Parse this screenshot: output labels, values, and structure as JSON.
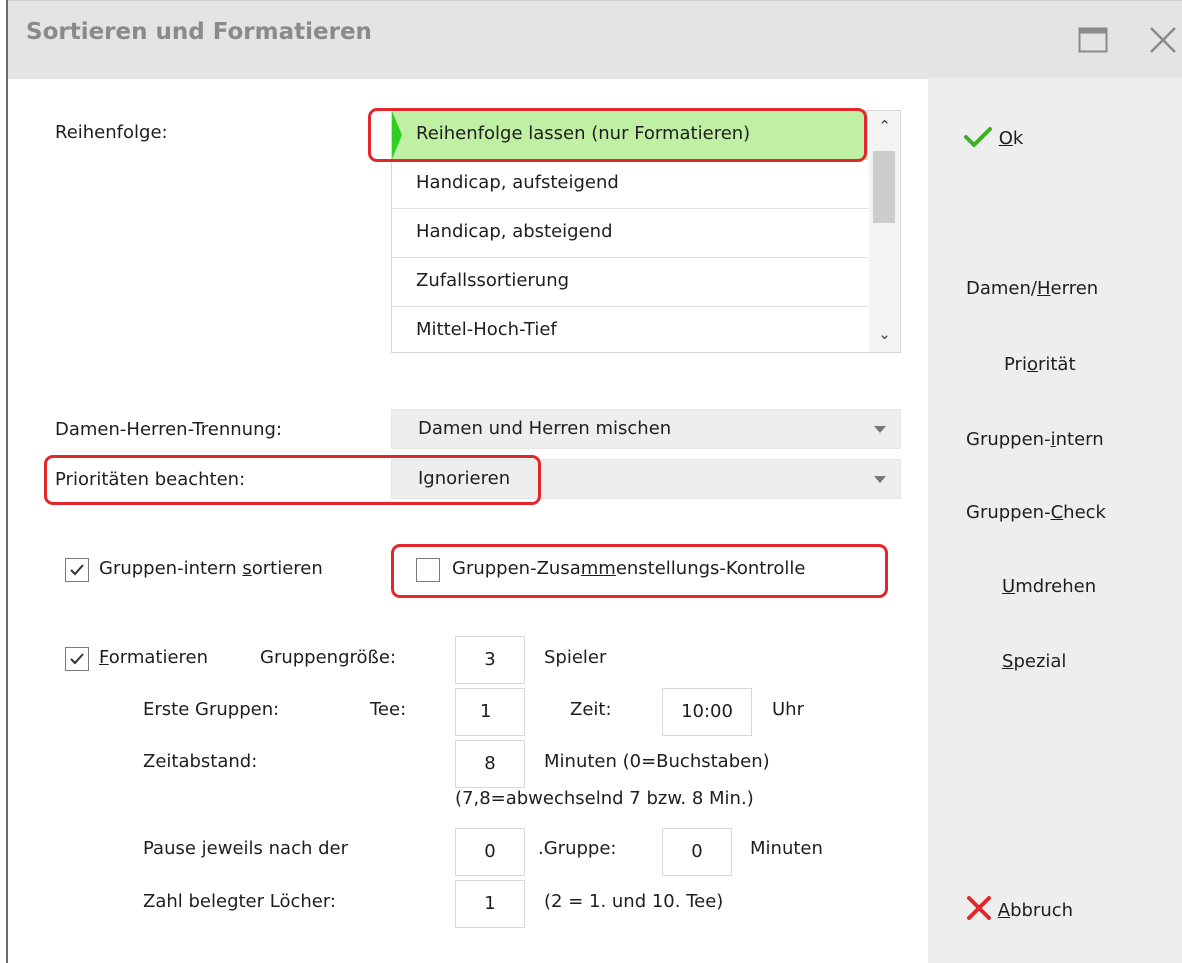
{
  "window": {
    "title": "Sortieren und Formatieren"
  },
  "order": {
    "label": "Reihenfolge:",
    "items": [
      "Reihenfolge lassen (nur Formatieren)",
      "Handicap, aufsteigend",
      "Handicap, absteigend",
      "Zufallssortierung",
      "Mittel-Hoch-Tief"
    ],
    "selected_index": 0
  },
  "gender": {
    "label": "Damen-Herren-Trennung:",
    "value": "Damen und Herren mischen"
  },
  "priority": {
    "label": "Prioritäten beachten:",
    "value": "Ignorieren"
  },
  "group_sort": {
    "label_a": "Gruppen-intern ",
    "label_u": "s",
    "label_b": "ortieren",
    "checked": true
  },
  "group_check": {
    "label_a": "Gruppen-Zusa",
    "label_u": "mm",
    "label_b": "enstellungs-Kontrolle",
    "checked": false
  },
  "format": {
    "label_u": "F",
    "label_rest": "ormatieren",
    "checked": true,
    "group_size_label": "Gruppengröße:",
    "group_size": "3",
    "group_size_unit": "Spieler",
    "first_groups_label": "Erste Gruppen:",
    "tee_label": "Tee:",
    "tee": "1",
    "time_label": "Zeit:",
    "time": "10:00",
    "time_unit": "Uhr",
    "interval_label": "Zeitabstand:",
    "interval": "8",
    "interval_unit": "Minuten (0=Buchstaben)",
    "interval_note": "(7,8=abwechselnd 7 bzw. 8 Min.)",
    "pause_label": "Pause jeweils nach der",
    "pause_group": "0",
    "pause_group_label": ".Gruppe:",
    "pause_minutes": "0",
    "pause_unit": "Minuten",
    "holes_label": "Zahl belegter Löcher:",
    "holes": "1",
    "holes_note": "(2 = 1. und 10. Tee)"
  },
  "sidebar": {
    "ok_u": "O",
    "ok_rest": "k",
    "damen_a": "Damen/",
    "damen_u": "H",
    "damen_b": "erren",
    "prio_a": "Pri",
    "prio_u": "o",
    "prio_b": "rität",
    "gi_a": "Gruppen-",
    "gi_u": "i",
    "gi_b": "ntern",
    "gc_a": "Gruppen-",
    "gc_u": "C",
    "gc_b": "heck",
    "umdrehen_u": "U",
    "umdrehen_rest": "mdrehen",
    "spezial_u": "S",
    "spezial_rest": "pezial",
    "abbruch_u": "A",
    "abbruch_rest": "bbruch"
  },
  "colors": {
    "selection": "#bff0a3",
    "highlight": "#e3262b",
    "ok": "#3cb01e",
    "cancel": "#e3262b"
  }
}
